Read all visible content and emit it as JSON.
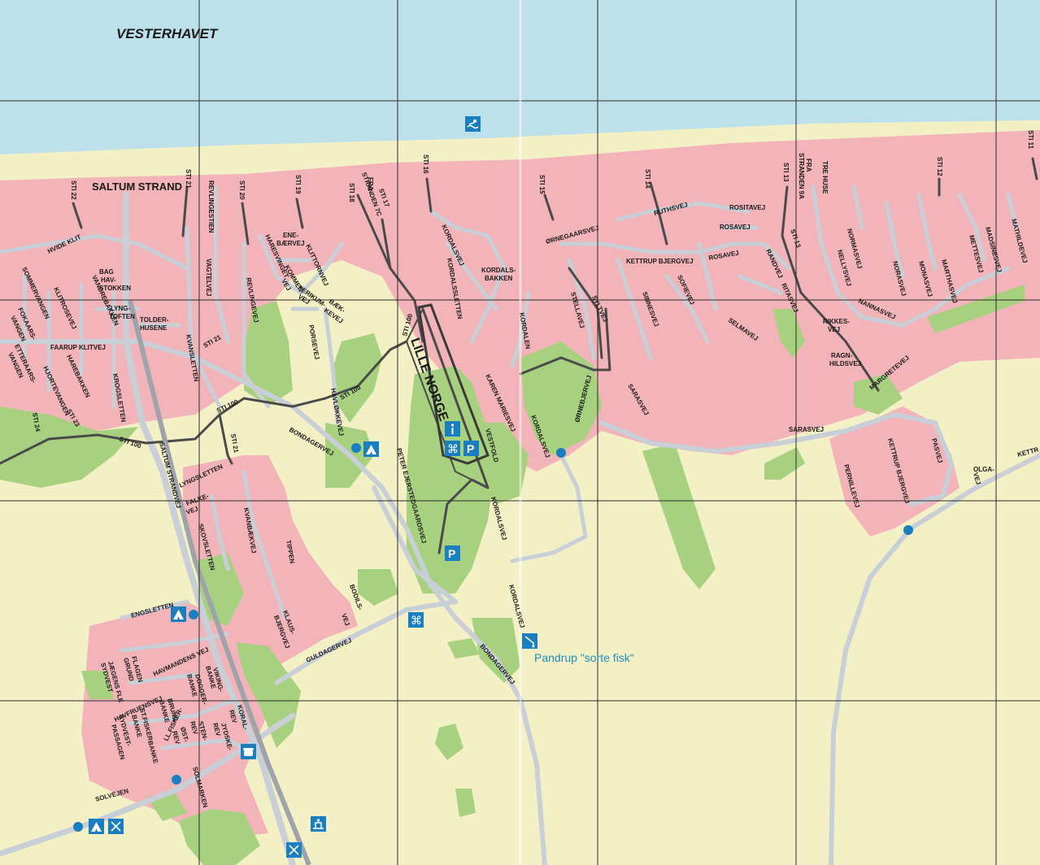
{
  "sea_label": "VESTERHAVET",
  "towns": {
    "saltum_strand": "SALTUM STRAND",
    "lille_norge": "LILLE NORGE"
  },
  "poi": {
    "pandrup": "Pandrup \"sorte fisk\""
  },
  "colors": {
    "sea": "#bde1ea",
    "beach": "#f4f0c6",
    "town": "#f2b3b9",
    "green": "#a8d17f",
    "road": "#c9cfd6",
    "path": "#4a4a4a",
    "icon": "#1a7fc1"
  },
  "icons": [
    "swimming-icon",
    "camping-icon",
    "info-icon",
    "parking-icon",
    "attraction-icon",
    "restaurant-icon",
    "telephone-icon",
    "fishing-icon",
    "playground-icon",
    "dot-marker"
  ],
  "streets": {
    "sti22": "STI 22",
    "sti21a": "STI 21",
    "sti20": "STI 20",
    "sti19": "STI 19",
    "sti18": "STI 18",
    "sti17": "STI 17",
    "sti16": "STI 16",
    "sti15": "STI 15",
    "sti14": "STI 14",
    "sti13a": "STI 13",
    "sti13b": "STI 13",
    "sti12": "STI 12",
    "sti11": "STI 11",
    "sti24": "STI 24",
    "sti23": "STI 23",
    "sti21b": "STI 21",
    "sti21c": "STI 21",
    "sti100a": "STI 100",
    "sti100b": "STI 100",
    "sti100c": "STI 100",
    "sti100d": "STI 100",
    "fra7c1": "FRA",
    "fra7c2": "STRANDEN 7C",
    "fra9a1": "FRA",
    "fra9a2": "STRANDEN 9A",
    "trehuse": "TRE HUSE",
    "hvideklit": "HVIDE KLIT",
    "bag1": "BAG",
    "bag2": "HAV-",
    "bag3": "STOKKEN",
    "sommer": "SOMMERVANGEN",
    "klitrosevej": "KLITROSEVEJ",
    "vandrebakken": "VANDREBAKKEN",
    "lyng1": "LYNG-",
    "lyng2": "TOFTEN",
    "tolder1": "TOLDER-",
    "tolder2": "HUSENE",
    "fokaars1": "FOKAARS-",
    "fokaars2": "VANGEN",
    "etteraars1": "ETTERAARS-",
    "etteraars2": "VANGEN",
    "faarup": "FAARUP KLITVEJ",
    "harebakken": "HAREBAKKEN",
    "hjortevangen": "HJORTEVANGEN",
    "krogsletten": "KROGSLETTEN",
    "kvansletten": "KVANSLETTEN",
    "revlingestien": "REVLINGESTIEN",
    "vagtelvej": "VAGTELVEJ",
    "revlingevej": "REVLINGEVEJ",
    "ene1": "ENE-",
    "ene2": "BÆRVEJ",
    "haresvin": "HARESVINGET",
    "kommen": "KOMMEN-",
    "kommen2": "VEJ",
    "klittorn": "KLITTORNVEJ",
    "perikum1": "PERIKUM-",
    "perikum2": "VEJ",
    "baek1": "BÆK-",
    "baek2": "KEVEJ",
    "porse": "PORSEVEJ",
    "havlokke": "HAVLØKKEVEJ",
    "bondager1": "BONDAGERVEJ",
    "bondager2": "BONDAGERVEJ",
    "kordalsvej1": "KORDALSVEJ",
    "kordalssletten": "KORDALSSLETTEN",
    "kordalsbakken1": "KORDALS-",
    "kordalsbakken2": "BAKKEN",
    "orne": "ØRNEGAARSVEJ",
    "stellavej": "STELLAVEJ",
    "syltvej": "SYLTVEJ",
    "kordalen": "KORDALEN",
    "karen": "KAREN MARIESVEJ",
    "vestfold": "VESTFOLD",
    "kordalsvej2": "KORDALSVEJ",
    "ornebjerg": "ØRNEBJERVEJ",
    "peter": "PETER EJERSTEDGAARDSVEJ",
    "kordalsvej3": "KORDALSVEJ",
    "kordalsvej4": "KORDALSVEJ",
    "ruthsvej": "RUTHSVEJ",
    "rositavej": "ROSITAVEJ",
    "rosavej1": "ROSAVEJ",
    "rosavej2": "ROSAVEJ",
    "kettrup": "KETTRUP BJERGVEJ",
    "sofievej": "SOFIEVEJ",
    "sinnesvej": "SINNESVEJ",
    "selmavej": "SELMAVEJ",
    "randvej": "RANDVEJ",
    "ritasvej": "RITASVEJ",
    "rikkes1": "RIKKES-",
    "rikkes2": "VEJ",
    "ragn1": "RAGN-",
    "ragn2": "HILDSVEJ",
    "sarasvej1": "SARASVEJ",
    "sarasvej2": "SARASVEJ",
    "normasvej": "NORMASVEJ",
    "nellysvej": "NELLYSVEJ",
    "norasvej": "NORASVEJ",
    "monasvej": "MONASVEJ",
    "marthasvej": "MARTHASVEJ",
    "mettesvej": "METTESVEJ",
    "madsinesvej": "MADSINESVEJ",
    "mathildevej": "MATHILDEVEJ",
    "nannasvej": "NANNASVEJ",
    "margretevej": "MARGRETEVEJ",
    "kettrup2": "KETTRUP BJERGVEJ",
    "pasvej": "PASVEJ",
    "olga1": "OLGA-",
    "olga2": "VEJ",
    "pernillevej": "PERNILLEVEJ",
    "kettr": "KETTR",
    "saltumstrandvej": "SALTUM STRANDVEJ",
    "lyngsletten": "LYNGSLETTEN",
    "falke1": "FALKE-",
    "falke2": "VEJ",
    "skovsletten": "SKOVSLETTEN",
    "kvanbaek": "KVANBÆKVEJ",
    "tippen": "TIPPEN",
    "klaus1": "KLAUS-",
    "klaus2": "BJERGVEJ",
    "bodils1": "BODILS-",
    "bodils2": "VEJ",
    "guldager": "GULDAGERVEJ",
    "kordalsvej5": "KORDALSVEJ",
    "bondager3": "BONDAGERVEJ",
    "engsletten": "ENGSLETTEN",
    "havmanden": "HAVMANDENS VEJ",
    "flagen1": "FLAGEN",
    "flagen2": "GRUND",
    "jaegens1": "JÆGENS FLE",
    "jaegens2": "SYDVEST",
    "viking1": "VIKING-",
    "viking2": "BANKE",
    "dogger1": "DOGGER-",
    "dogger2": "BANKE",
    "haverfruens": "HAVFRUENSVEJ",
    "brune1": "BRUNE",
    "brune2": "BANKE",
    "stfisker1": "ST.FISKER-",
    "stfisker2": "BANKE",
    "sydvest1": "SYDVEST-",
    "sydvest2": "PASSAGEN",
    "llfisker1": "LL.FISKER-",
    "llfisker2": "BANKE",
    "ost1": "ØST-",
    "ost2": "REV",
    "koral1": "KORAL-",
    "koral2": "REV",
    "jydske1": "JYDSKE-",
    "jydske2": "REV",
    "sten1": "STEN-",
    "sten2": "REV",
    "solvejen": "SOLVEJEN",
    "solmarken": "SOLMARKEN"
  }
}
